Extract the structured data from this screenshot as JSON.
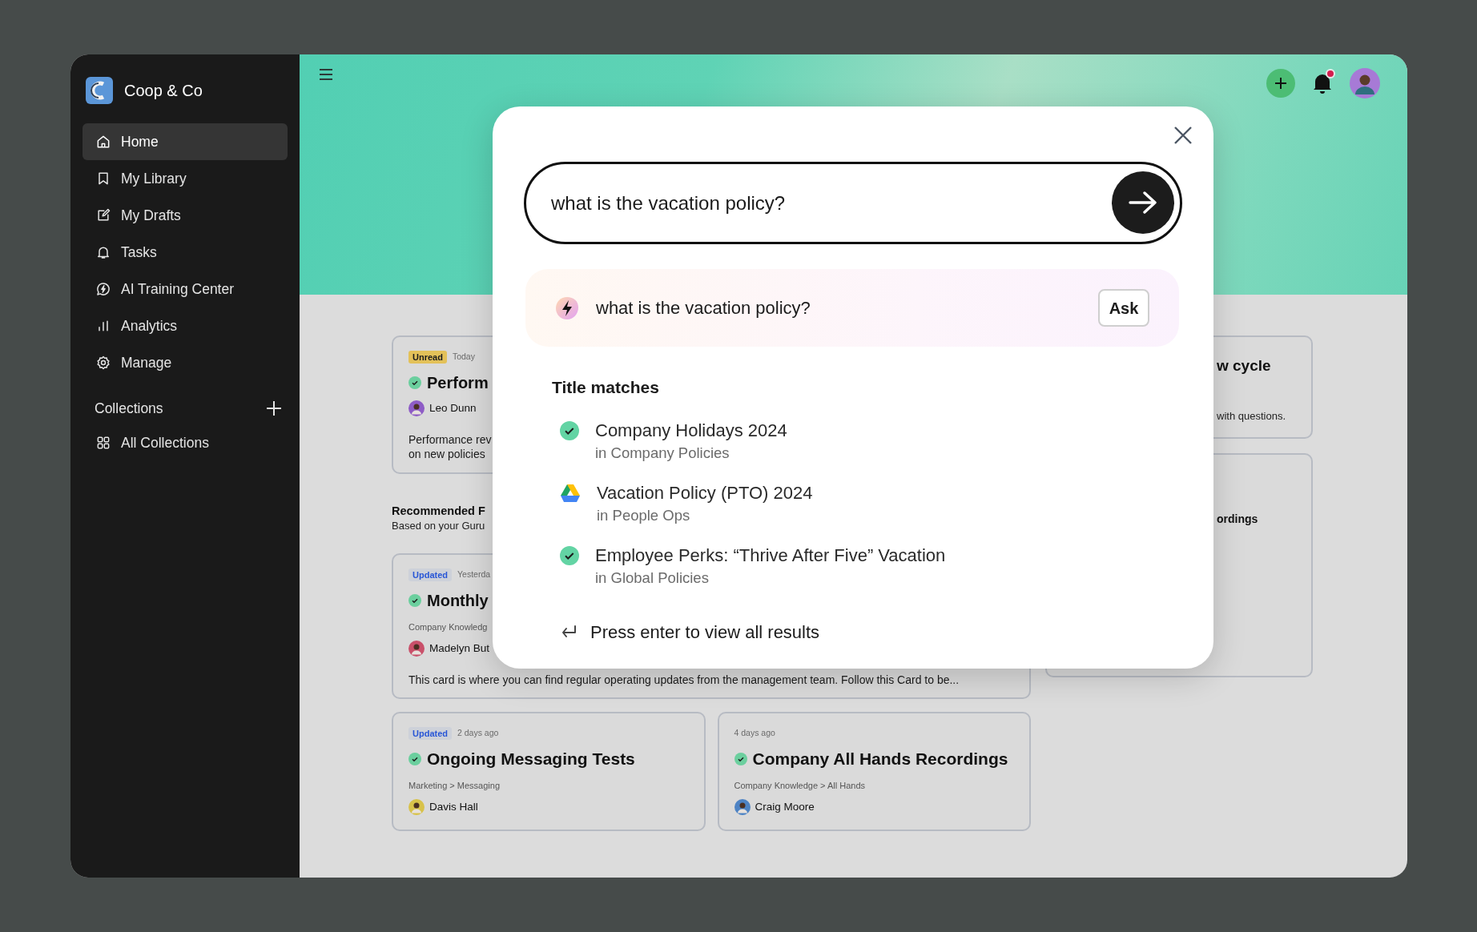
{
  "sidebar": {
    "brand": "Coop & Co",
    "nav": [
      {
        "label": "Home",
        "selected": true
      },
      {
        "label": "My Library",
        "selected": false
      },
      {
        "label": "My Drafts",
        "selected": false
      },
      {
        "label": "Tasks",
        "selected": false
      },
      {
        "label": "AI Training Center",
        "selected": false
      },
      {
        "label": "Analytics",
        "selected": false
      },
      {
        "label": "Manage",
        "selected": false
      }
    ],
    "collections": {
      "title": "Collections",
      "items": [
        {
          "label": "All Collections",
          "selected": false
        }
      ]
    }
  },
  "topbar": {
    "notifications": {
      "unread": true
    }
  },
  "home": {
    "top_cards": [
      {
        "badge": {
          "label": "Unread",
          "kind": "unread"
        },
        "time": "Today",
        "verified": true,
        "title": "Perform",
        "author": "Leo Dunn",
        "body": [
          "Performance rev",
          "on new policies"
        ]
      }
    ],
    "recommended": {
      "title": "Recommended F",
      "subtitle": "Based on your Guru",
      "cards": [
        {
          "badge": {
            "label": "Updated",
            "kind": "updated"
          },
          "time": "Yesterda",
          "verified": true,
          "title": "Monthly",
          "path": "Company Knowledg",
          "author": "Madelyn But",
          "body": [
            "This card is where you can find regular operating updates from the management team. Follow this Card to be..."
          ]
        },
        {
          "badge": {
            "label": "Updated",
            "kind": "updated"
          },
          "time": "2 days ago",
          "verified": true,
          "title": "Ongoing Messaging Tests",
          "path": "Marketing > Messaging",
          "author": "Davis Hall"
        },
        {
          "time": "4 days ago",
          "verified": true,
          "title": "Company All Hands Recordings",
          "path": "Company Knowledge > All Hands",
          "author": "Craig Moore"
        }
      ]
    },
    "side_cards": [
      {
        "title": "w cycle",
        "text": "with questions."
      },
      {
        "title": "ordings"
      }
    ]
  },
  "search_modal": {
    "query": "what is the vacation policy?",
    "suggestion": {
      "text": "what is the vacation policy?",
      "action": "Ask"
    },
    "section_title": "Title matches",
    "results": [
      {
        "title": "Company Holidays 2024",
        "location": "in Company Policies",
        "kind": "verified"
      },
      {
        "title": "Vacation Policy (PTO) 2024",
        "location": "in People Ops",
        "kind": "drive"
      },
      {
        "title": "Employee Perks: “Thrive After Five” Vacation",
        "location": "in Global Policies",
        "kind": "verified"
      }
    ],
    "footer": "Press enter to view all results"
  }
}
